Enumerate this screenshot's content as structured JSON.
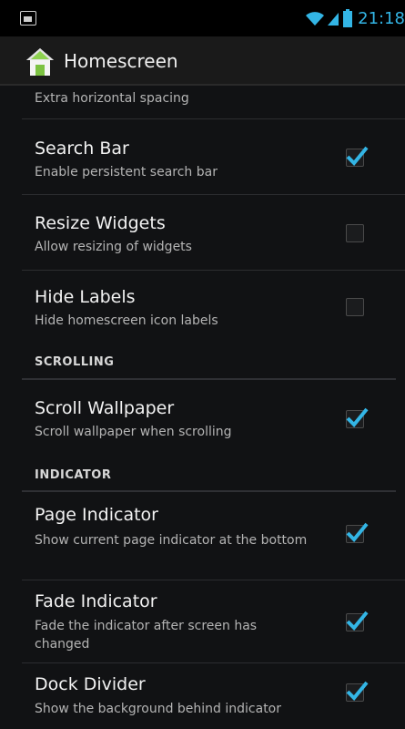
{
  "status_bar": {
    "time": "21:18",
    "icons": [
      "image-notification-icon",
      "wifi-icon",
      "signal-icon",
      "battery-icon"
    ]
  },
  "action_bar": {
    "title": "Homescreen",
    "icon": "home-icon"
  },
  "preferences": {
    "partial_summary": "Extra horizontal spacing",
    "search_bar": {
      "title": "Search Bar",
      "summary": "Enable persistent search bar",
      "checked": true
    },
    "resize_widgets": {
      "title": "Resize Widgets",
      "summary": "Allow resizing of widgets",
      "checked": false
    },
    "hide_labels": {
      "title": "Hide Labels",
      "summary": "Hide homescreen icon labels",
      "checked": false
    },
    "scroll_wallpaper": {
      "title": "Scroll Wallpaper",
      "summary": "Scroll wallpaper when scrolling",
      "checked": true
    },
    "page_indicator": {
      "title": "Page Indicator",
      "summary": "Show current page indicator at the bottom",
      "checked": true
    },
    "fade_indicator": {
      "title": "Fade Indicator",
      "summary": "Fade the indicator after screen has changed",
      "checked": true
    },
    "dock_divider": {
      "title": "Dock Divider",
      "summary": "Show the background behind indicator",
      "checked": true
    }
  },
  "sections": {
    "scrolling": "SCROLLING",
    "indicator": "INDICATOR"
  },
  "colors": {
    "accent": "#33b5e5",
    "background": "#111214",
    "action_bar": "#1a1a1a"
  }
}
